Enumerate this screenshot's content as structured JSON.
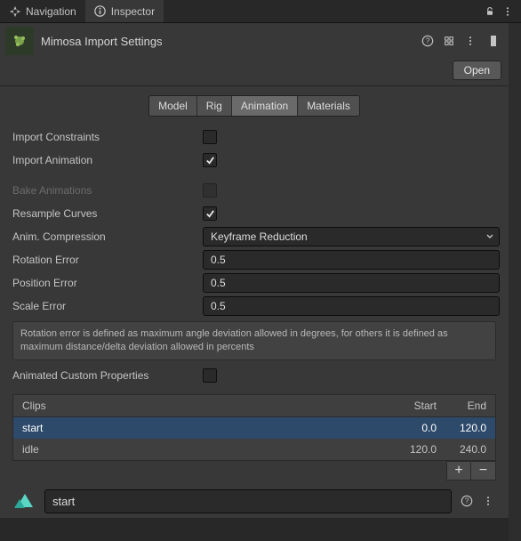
{
  "tabs": {
    "nav": "Navigation",
    "inspector": "Inspector"
  },
  "header": {
    "title": "Mimosa Import Settings",
    "open": "Open"
  },
  "segments": {
    "model": "Model",
    "rig": "Rig",
    "animation": "Animation",
    "materials": "Materials"
  },
  "props": {
    "importConstraints": "Import Constraints",
    "importAnimation": "Import Animation",
    "bakeAnimations": "Bake Animations",
    "resampleCurves": "Resample Curves",
    "animCompression": "Anim. Compression",
    "rotationError": "Rotation Error",
    "positionError": "Position Error",
    "scaleError": "Scale Error",
    "animatedCustomProperties": "Animated Custom Properties"
  },
  "values": {
    "animCompression": "Keyframe Reduction",
    "rotationError": "0.5",
    "positionError": "0.5",
    "scaleError": "0.5"
  },
  "hint": "Rotation error is defined as maximum angle deviation allowed in degrees, for others it is defined as maximum distance/delta deviation allowed in percents",
  "clips": {
    "header": {
      "name": "Clips",
      "start": "Start",
      "end": "End"
    },
    "rows": [
      {
        "name": "start",
        "start": "0.0",
        "end": "120.0"
      },
      {
        "name": "idle",
        "start": "120.0",
        "end": "240.0"
      }
    ],
    "plus": "+",
    "minus": "−"
  },
  "clipEdit": {
    "name": "start"
  }
}
